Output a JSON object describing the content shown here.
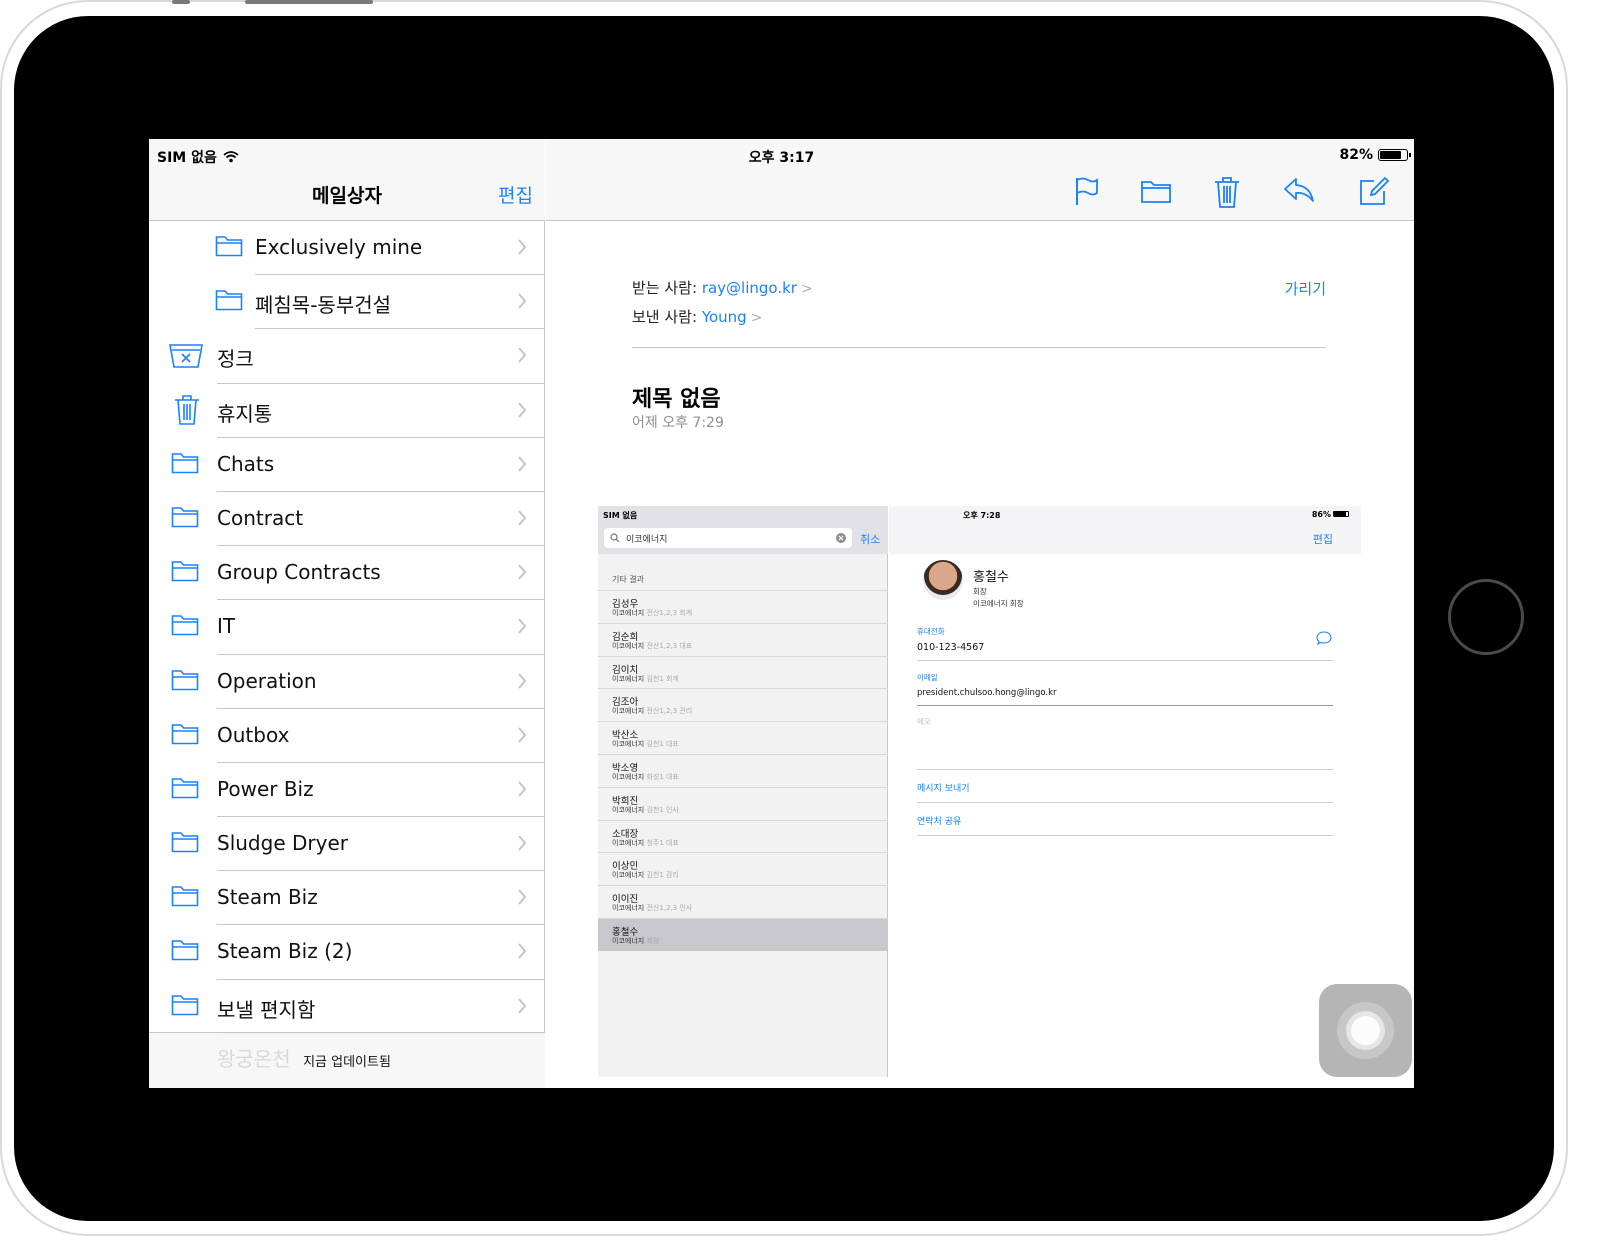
{
  "status_bar": {
    "carrier": "SIM 없음",
    "time": "오후 3:17",
    "battery_text": "82%",
    "battery_level": 0.82
  },
  "sidebar": {
    "title": "메일상자",
    "edit_label": "편집",
    "folders": [
      {
        "label": "Exclusively mine",
        "icon": "folder-icon"
      },
      {
        "label": "폐침목-동부건설",
        "icon": "folder-icon"
      },
      {
        "label": "정크",
        "icon": "junk-icon"
      },
      {
        "label": "휴지통",
        "icon": "trash-icon"
      },
      {
        "label": "Chats",
        "icon": "folder-icon"
      },
      {
        "label": "Contract",
        "icon": "folder-icon"
      },
      {
        "label": "Group Contracts",
        "icon": "folder-icon"
      },
      {
        "label": "IT",
        "icon": "folder-icon"
      },
      {
        "label": "Operation",
        "icon": "folder-icon"
      },
      {
        "label": "Outbox",
        "icon": "folder-icon"
      },
      {
        "label": "Power Biz",
        "icon": "folder-icon"
      },
      {
        "label": "Sludge Dryer",
        "icon": "folder-icon"
      },
      {
        "label": "Steam Biz",
        "icon": "folder-icon"
      },
      {
        "label": "Steam Biz (2)",
        "icon": "folder-icon"
      },
      {
        "label": "보낼 편지함",
        "icon": "folder-icon"
      }
    ],
    "footer_ghost": "왕궁온천",
    "footer_status": "지금 업데이트됨"
  },
  "toolbar": {
    "icons": [
      "flag-icon",
      "folder-move-icon",
      "trash-icon",
      "reply-icon",
      "compose-icon"
    ],
    "accent": "#1a82fb"
  },
  "message": {
    "to_label": "받는 사람:",
    "to_value": "ray@lingo.kr",
    "from_label": "보낸 사람:",
    "from_value": "Young",
    "hide_label": "가리기",
    "subject": "제목 없음",
    "date": "어제 오후 7:29"
  },
  "embedded": {
    "carrier": "SIM 없음",
    "time": "오후 7:28",
    "battery_text": "86%",
    "search_value": "이코에너지",
    "cancel_label": "취소",
    "section_label": "기타 결과",
    "results": [
      {
        "name": "김성우",
        "org": "이코에너지",
        "detail": "전산1,2,3 회계"
      },
      {
        "name": "김순희",
        "org": "이코에너지",
        "detail": "전산1,2,3 대표"
      },
      {
        "name": "김이치",
        "org": "이코에너지",
        "detail": "김천1 회계"
      },
      {
        "name": "김조아",
        "org": "이코에너지",
        "detail": "전산1,2,3 관리"
      },
      {
        "name": "박산소",
        "org": "이코에너지",
        "detail": "김천1 대표"
      },
      {
        "name": "박소영",
        "org": "이코에너지",
        "detail": "화성1 대표"
      },
      {
        "name": "박희진",
        "org": "이코에너지",
        "detail": "김천1 인사"
      },
      {
        "name": "소대장",
        "org": "이코에너지",
        "detail": "청주1 대표"
      },
      {
        "name": "이상민",
        "org": "이코에너지",
        "detail": "김천1 감리"
      },
      {
        "name": "이이진",
        "org": "이코에너지",
        "detail": "전산1,2,3 인사"
      },
      {
        "name": "홍철수",
        "org": "이코에너지",
        "detail": "회장"
      }
    ],
    "edit_label": "편집",
    "contact": {
      "name": "홍철수",
      "title": "회장",
      "company": "이코에너지 회장",
      "phone_label": "휴대전화",
      "phone": "010-123-4567",
      "email_label": "이메일",
      "email": "president.chulsoo.hong@lingo.kr",
      "memo_label": "메모",
      "send_message": "메시지 보내기",
      "share_contact": "연락처 공유"
    }
  }
}
